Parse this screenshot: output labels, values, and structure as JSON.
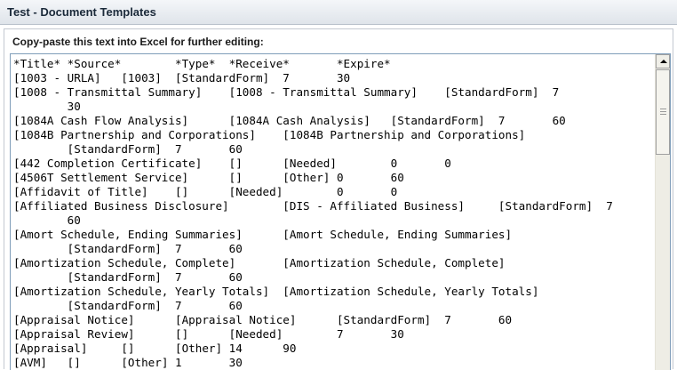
{
  "window": {
    "title": "Test - Document Templates"
  },
  "panel": {
    "label": "Copy-paste this text into Excel for further editing:"
  },
  "textarea": {
    "content": "*Title*\t*Source*\t*Type*\t*Receive*\t*Expire*\n[1003 - URLA]\t[1003]\t[StandardForm]\t7\t30\n[1008 - Transmittal Summary]\t[1008 - Transmittal Summary]\t[StandardForm]\t7\n\t30\n[1084A Cash Flow Analysis]\t[1084A Cash Analysis]\t[StandardForm]\t7\t60\n[1084B Partnership and Corporations]\t[1084B Partnership and Corporations]\n\t[StandardForm]\t7\t60\n[442 Completion Certificate]\t[]\t[Needed]\t0\t0\n[4506T Settlement Service]\t[]\t[Other]\t0\t60\n[Affidavit of Title]\t[]\t[Needed]\t0\t0\n[Affiliated Business Disclosure]\t[DIS - Affiliated Business]\t[StandardForm]\t7\n\t60\n[Amort Schedule, Ending Summaries]\t[Amort Schedule, Ending Summaries]\n\t[StandardForm]\t7\t60\n[Amortization Schedule, Complete]\t[Amortization Schedule, Complete]\n\t[StandardForm]\t7\t60\n[Amortization Schedule, Yearly Totals]\t[Amortization Schedule, Yearly Totals]\n\t[StandardForm]\t7\t60\n[Appraisal Notice]\t[Appraisal Notice]\t[StandardForm]\t7\t60\n[Appraisal Review]\t[]\t[Needed]\t7\t30\n[Appraisal]\t[]\t[Other]\t14\t90\n[AVM]\t[]\t[Other]\t1\t30"
  },
  "scrollbar": {
    "position": 0
  }
}
